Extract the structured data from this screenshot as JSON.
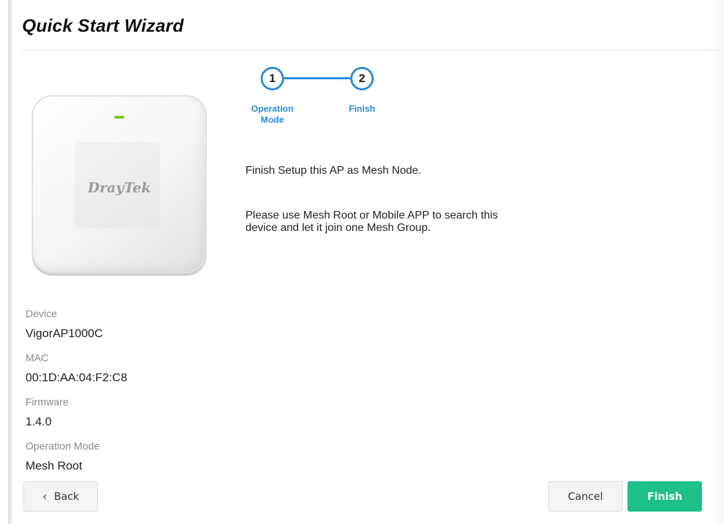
{
  "header": {
    "title": "Quick Start Wizard"
  },
  "device_image": {
    "brand_logo": "DrayTek",
    "led_color": "#7cc520"
  },
  "stepper": {
    "steps": [
      {
        "number": "1",
        "label_line1": "Operation",
        "label_line2": "Mode"
      },
      {
        "number": "2",
        "label_line1": "Finish",
        "label_line2": ""
      }
    ],
    "accent_color": "#2a8ad9"
  },
  "content": {
    "finish_message": "Finish Setup this AP as Mesh Node.",
    "instructions_line1": "Please use Mesh Root or Mobile APP to search this",
    "instructions_line2": "device and let it join one Mesh Group."
  },
  "device_info": {
    "device_label": "Device",
    "device_value": "VigorAP1000C",
    "mac_label": "MAC",
    "mac_value": "00:1D:AA:04:F2:C8",
    "firmware_label": "Firmware",
    "firmware_value": "1.4.0",
    "mode_label": "Operation Mode",
    "mode_value": "Mesh Root"
  },
  "buttons": {
    "back_icon": "chevron-left-icon",
    "back_label": "Back",
    "cancel_label": "Cancel",
    "finish_label": "Finish",
    "finish_color": "#1dbf8a"
  }
}
